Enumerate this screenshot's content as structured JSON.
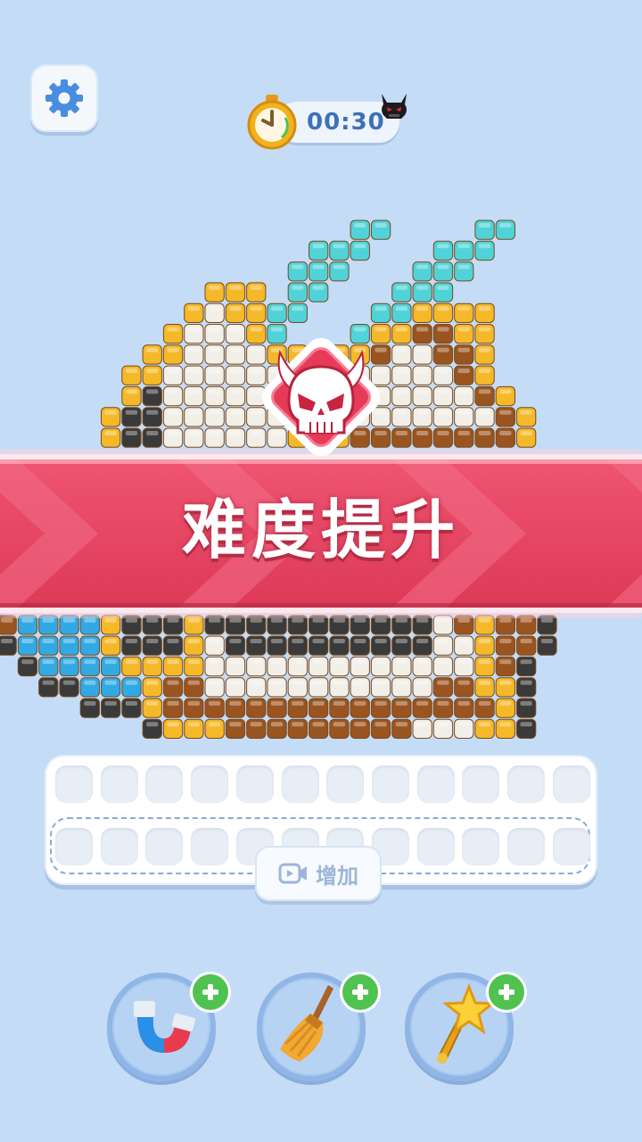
{
  "timer": {
    "value": "00:30"
  },
  "banner": {
    "title": "难度提升"
  },
  "tray": {
    "add_label": "增加"
  },
  "powerups": [
    {
      "name": "magnet",
      "icon": "magnet-icon"
    },
    {
      "name": "broom",
      "icon": "broom-icon"
    },
    {
      "name": "star-wand",
      "icon": "star-wand-icon"
    }
  ],
  "colors": {
    "background": "#c4dcf6",
    "banner": "#e84a64",
    "accent_blue": "#3e70b8",
    "bead_yellow": "#f5b829",
    "bead_teal": "#4fd3d8",
    "bead_white": "#f2efe9",
    "bead_black": "#3a3a3a",
    "bead_brown": "#9a5420",
    "bead_blue": "#31a9e4"
  }
}
